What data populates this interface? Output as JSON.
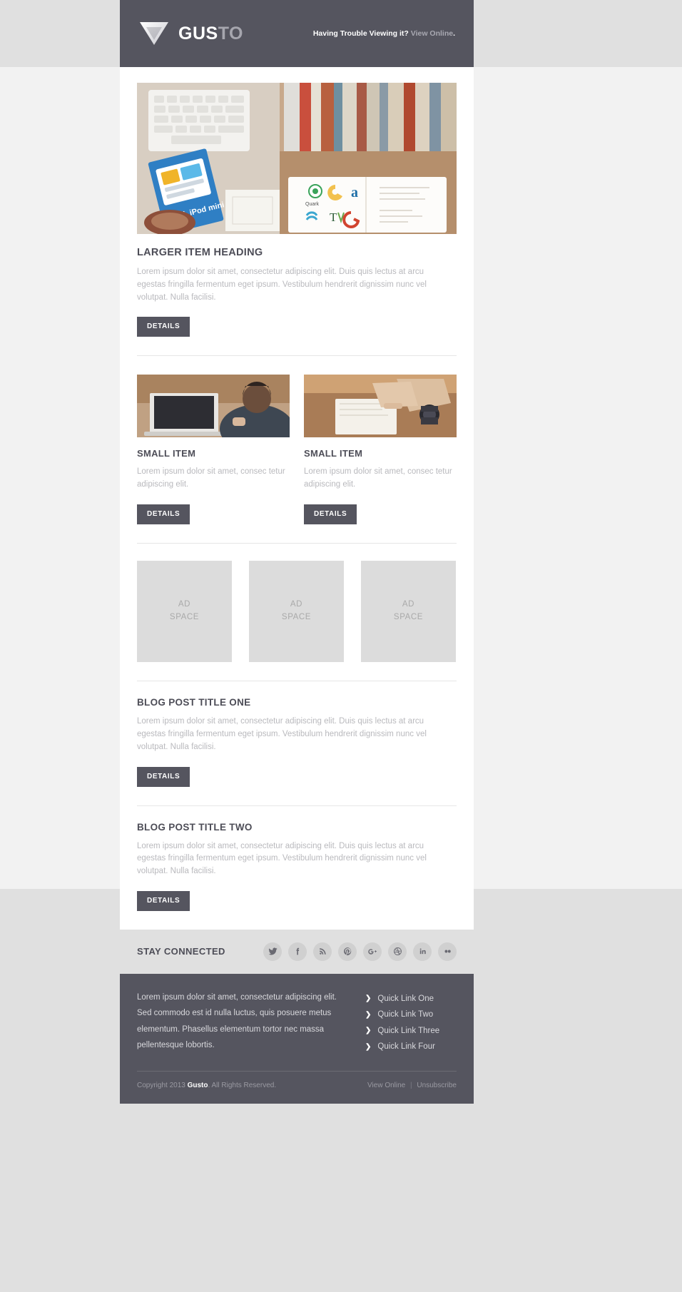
{
  "header": {
    "brand_primary": "GUS",
    "brand_secondary": "TO",
    "logo_icon": "triangle-logo-icon",
    "trouble_text": "Having Trouble Viewing it?",
    "view_online_label": "View Online",
    "period": "."
  },
  "hero": {
    "alt": "desk-photo-laptop-books"
  },
  "feature": {
    "heading": "LARGER ITEM HEADING",
    "body": "Lorem ipsum dolor sit amet, consectetur adipiscing elit. Duis quis lectus at arcu egestas fringilla fermentum eget ipsum. Vestibulum hendrerit dignissim nunc vel volutpat. Nulla facilisi.",
    "button_label": "DETAILS"
  },
  "small_items": [
    {
      "heading": "SMALL ITEM",
      "body": "Lorem ipsum dolor sit amet, consec tetur adipiscing elit.",
      "button_label": "DETAILS",
      "image_alt": "person-at-laptop-photo"
    },
    {
      "heading": "SMALL ITEM",
      "body": "Lorem ipsum dolor sit amet, consec tetur adipiscing elit.",
      "button_label": "DETAILS",
      "image_alt": "hands-writing-notebook-photo"
    }
  ],
  "ads": [
    {
      "line1": "AD",
      "line2": "SPACE"
    },
    {
      "line1": "AD",
      "line2": "SPACE"
    },
    {
      "line1": "AD",
      "line2": "SPACE"
    }
  ],
  "posts": [
    {
      "heading": "BLOG POST TITLE ONE",
      "body": "Lorem ipsum dolor sit amet, consectetur adipiscing elit. Duis quis lectus at arcu egestas fringilla fermentum eget ipsum. Vestibulum hendrerit dignissim nunc vel volutpat. Nulla facilisi.",
      "button_label": "DETAILS"
    },
    {
      "heading": "BLOG POST TITLE TWO",
      "body": "Lorem ipsum dolor sit amet, consectetur adipiscing elit. Duis quis lectus at arcu egestas fringilla fermentum eget ipsum. Vestibulum hendrerit dignissim nunc vel volutpat. Nulla facilisi.",
      "button_label": "DETAILS"
    }
  ],
  "social": {
    "title": "STAY CONNECTED",
    "icons": [
      "twitter-icon",
      "facebook-icon",
      "rss-icon",
      "pinterest-icon",
      "google-plus-icon",
      "dribbble-icon",
      "linkedin-icon",
      "flickr-icon"
    ]
  },
  "footer": {
    "about_text": "Lorem ipsum dolor sit amet, consectetur adipiscing elit. Sed commodo est id nulla luctus, quis posuere metus elementum. Phasellus elementum tortor nec massa pellentesque lobortis.",
    "quick_links": [
      "Quick Link One",
      "Quick Link Two",
      "Quick Link Three",
      "Quick Link Four"
    ],
    "copyright_prefix": "Copyright 2013",
    "copyright_brand": "Gusto",
    "copyright_suffix": ". All Rights Reserved.",
    "view_online_label": "View Online",
    "separator": "|",
    "unsubscribe_label": "Unsubscribe"
  },
  "colors": {
    "dark": "#55555f",
    "page": "#ececec",
    "body_text": "#b9b9bd",
    "heading": "#4d4d57",
    "ad_bg": "#dcdcdc"
  }
}
